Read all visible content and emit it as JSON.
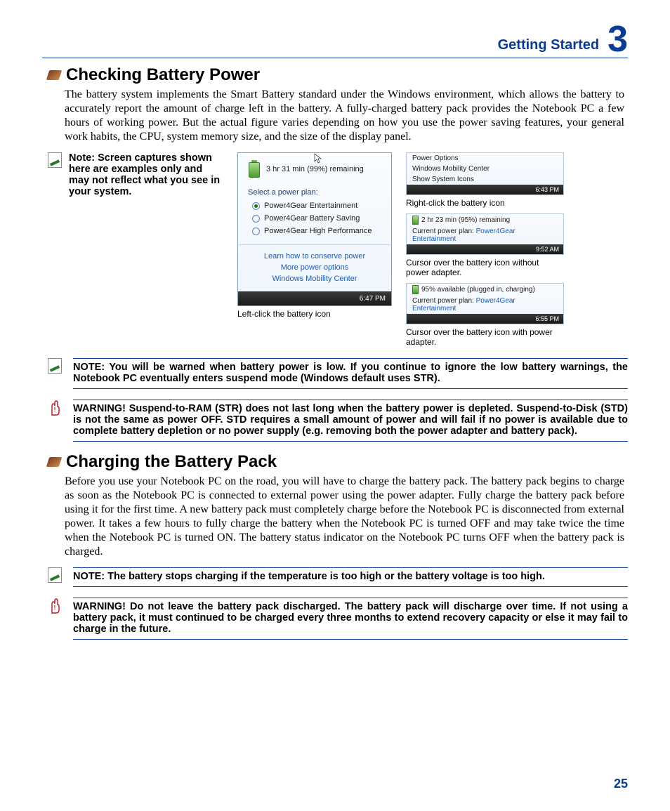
{
  "header": {
    "title": "Getting Started",
    "chapter": "3"
  },
  "section1": {
    "heading": "Checking Battery Power",
    "body": "The battery system implements the Smart Battery standard under the Windows environment, which allows the battery to accurately report the amount of charge left in the battery. A fully-charged battery pack provides the Notebook PC a few hours of working power. But the actual figure varies depending on how you use the power saving features, your general work habits, the CPU, system memory size, and the size of the display panel."
  },
  "example_note": "Note: Screen captures shown here are examples only and may not reflect what you see in your system.",
  "flyout": {
    "remaining": "3 hr 31 min (99%) remaining",
    "plan_label": "Select a power plan:",
    "plans": [
      "Power4Gear Entertainment",
      "Power4Gear Battery Saving",
      "Power4Gear High Performance"
    ],
    "link1": "Learn how to conserve power",
    "link2": "More power options",
    "link3": "Windows Mobility Center",
    "time": "6:47 PM",
    "caption": "Left-click the battery icon"
  },
  "right_panels": {
    "context": {
      "items": [
        "Power Options",
        "Windows Mobility Center",
        "Show System Icons"
      ],
      "time": "6:43 PM",
      "caption": "Right-click the battery icon"
    },
    "hover1": {
      "line1": "2 hr 23 min (95%) remaining",
      "line2a": "Current power plan:",
      "line2b": "Power4Gear Entertainment",
      "time": "9:52 AM",
      "caption": "Cursor over the battery icon without power adapter."
    },
    "hover2": {
      "line1": "95% available (plugged in, charging)",
      "line2a": "Current power plan:",
      "line2b": "Power4Gear Entertainment",
      "time": "6:55 PM",
      "caption": "Cursor over the battery icon with power adapter."
    }
  },
  "note1": "NOTE: You will be warned when battery power is low. If you continue to ignore the low battery warnings, the Notebook PC eventually enters suspend mode (Windows default uses STR).",
  "warning1": "WARNING!  Suspend-to-RAM (STR) does not last long when the battery power is depleted. Suspend-to-Disk (STD) is not the same as power OFF. STD requires a small amount of power and will fail if no power is available due to complete battery depletion or no power supply (e.g. removing both the power adapter and battery pack).",
  "section2": {
    "heading": "Charging the Battery Pack",
    "body": "Before you use your Notebook PC on the road, you will have to charge the battery pack. The battery pack begins to charge as soon as the Notebook PC is connected to external power using the power adapter. Fully charge the battery pack before using it for the first time. A new battery pack must completely charge before the Notebook PC is disconnected from external power. It takes a few hours to fully charge the battery when the Notebook PC is turned OFF and may take twice the time when the Notebook PC is turned ON. The battery status indicator on the Notebook PC turns OFF when the battery pack is charged."
  },
  "note2": "NOTE: The battery stops charging if the temperature is too high or the battery voltage is too high.",
  "warning2": "WARNING!  Do not leave the battery pack discharged. The battery pack will discharge over time. If not using a battery pack, it must continued to be charged every three months to extend recovery capacity or else it may fail to charge in the future.",
  "pagenum": "25"
}
